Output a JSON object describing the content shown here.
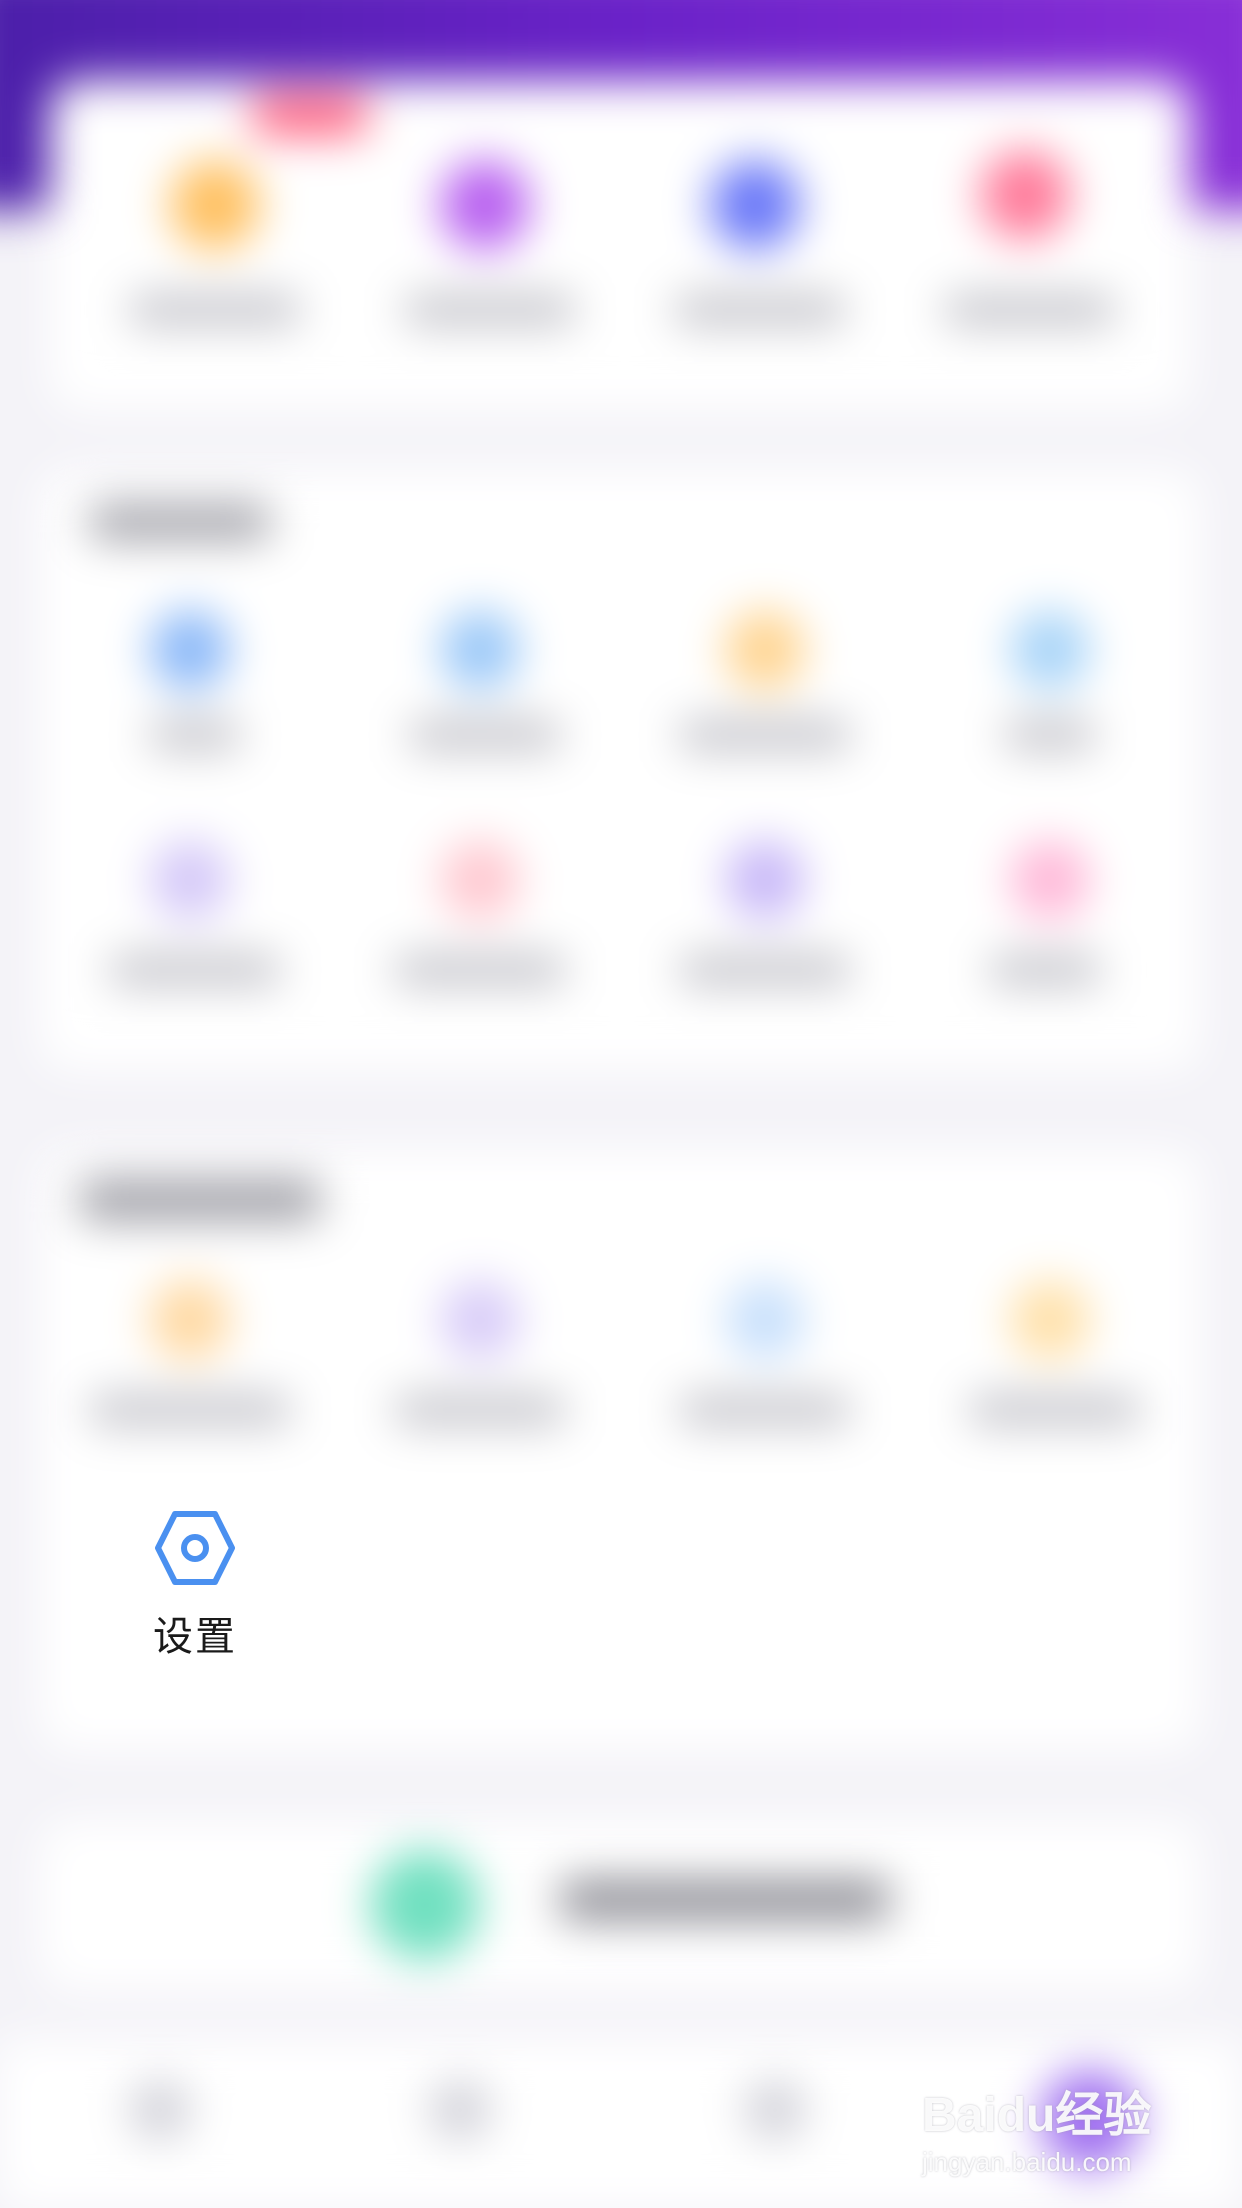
{
  "settings": {
    "label": "设置",
    "icon": "settings-hexagon-icon",
    "icon_color": "#4a90f0"
  },
  "watermark": {
    "brand": "Baidu经验",
    "url": "jingyan.baidu.com"
  },
  "colors": {
    "header_purple": "#5a20b8",
    "page_background": "#f4f3f8"
  }
}
